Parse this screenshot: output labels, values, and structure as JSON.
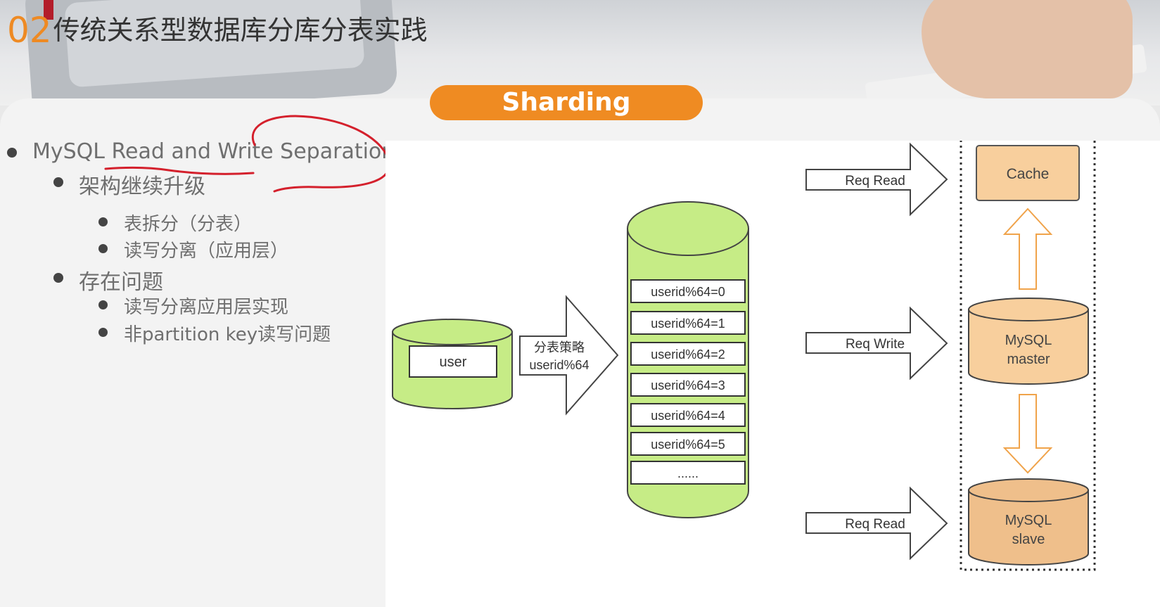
{
  "header": {
    "number": "02",
    "title": "传统关系型数据库分库分表实践"
  },
  "banner": {
    "label": "Sharding"
  },
  "bullets": {
    "l1": "MySQL Read and Write Separation",
    "upgrade": "架构继续升级",
    "split": "表拆分（分表）",
    "rw": "读写分离（应用层）",
    "problems": "存在问题",
    "p1": "读写分离应用层实现",
    "p2": "非partition key读写问题"
  },
  "diagram": {
    "user": "user",
    "strategy_line1": "分表策略",
    "strategy_line2": "userid%64",
    "shards": [
      "userid%64=0",
      "userid%64=1",
      "userid%64=2",
      "userid%64=3",
      "userid%64=4",
      "userid%64=5",
      "......"
    ],
    "req_read_top": "Req Read",
    "req_write": "Req Write",
    "req_read_bottom": "Req Read",
    "cache": "Cache",
    "master_line1": "MySQL",
    "master_line2": "master",
    "slave_line1": "MySQL",
    "slave_line2": "slave"
  },
  "colors": {
    "accent_orange": "#ef8b22",
    "shard_green": "#c6ec86",
    "node_orange": "#f8cf9d",
    "slave_tan": "#efbf8b",
    "ink_red": "#d4202c"
  }
}
